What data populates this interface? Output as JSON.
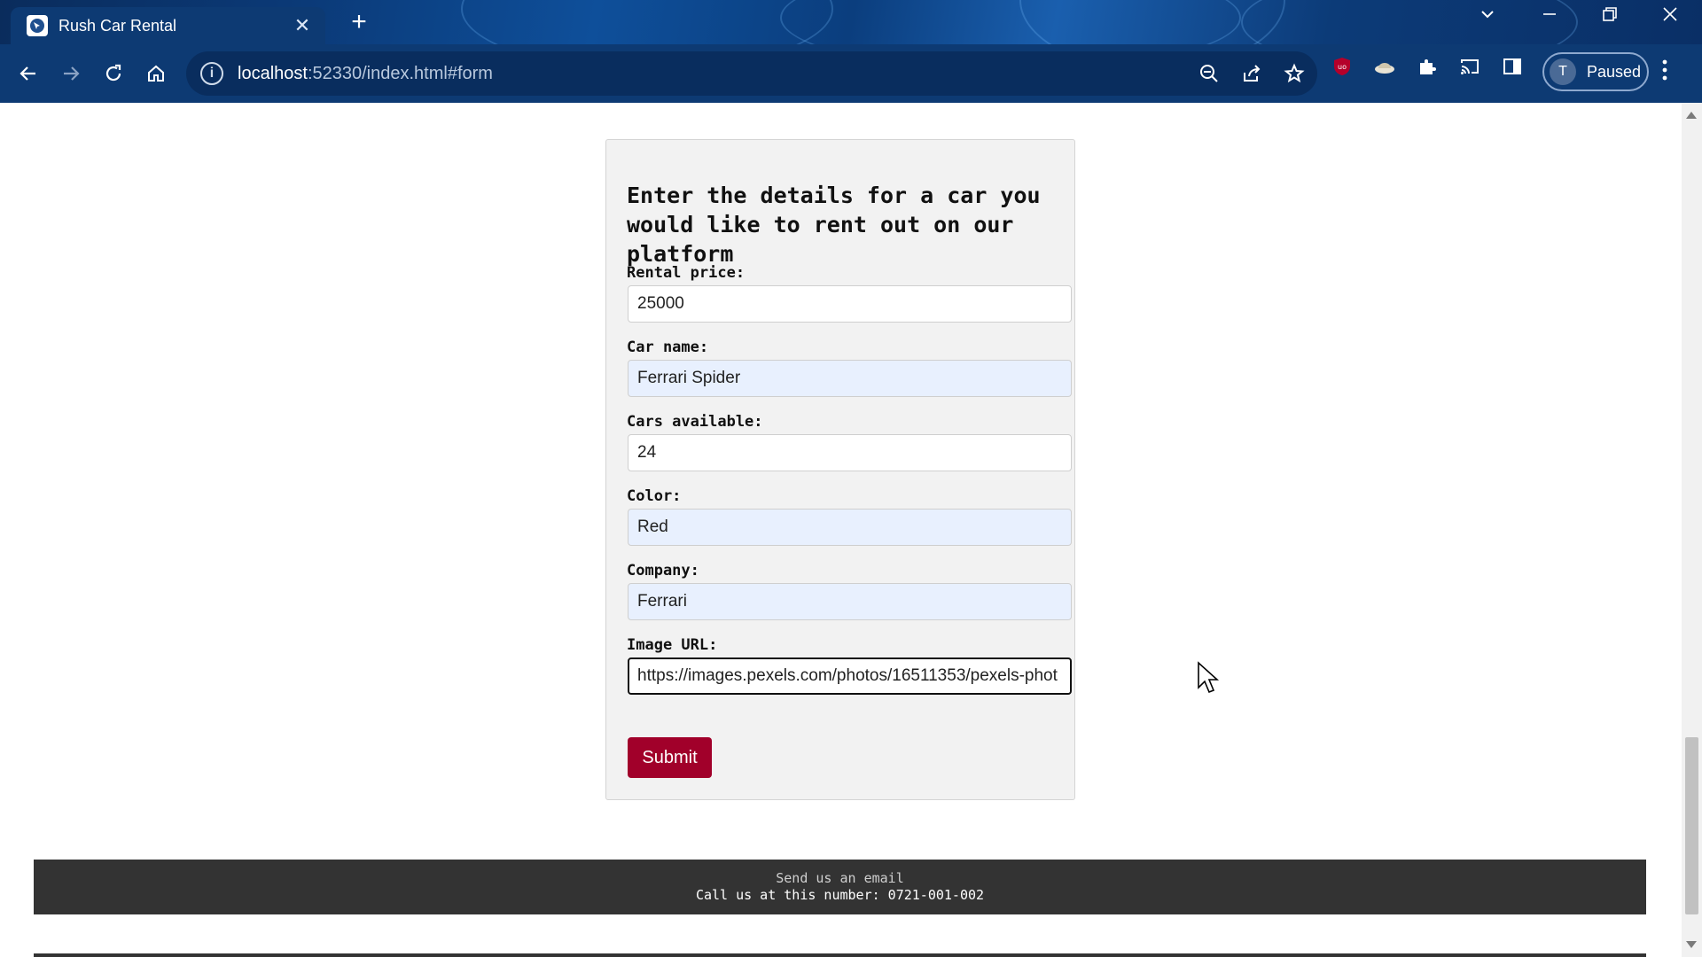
{
  "browser": {
    "tab_title": "Rush Car Rental",
    "tab_close": "✕",
    "new_tab": "+",
    "url_host": "localhost",
    "url_rest": ":52330/index.html#form",
    "profile_initial": "T",
    "profile_status": "Paused"
  },
  "form": {
    "heading": "Enter the details for a car you would like to rent out on our platform",
    "fields": [
      {
        "label": "Rental price:",
        "value": "25000"
      },
      {
        "label": "Car name:",
        "value": "Ferrari Spider"
      },
      {
        "label": "Cars available:",
        "value": "24"
      },
      {
        "label": "Color:",
        "value": "Red"
      },
      {
        "label": "Company:",
        "value": "Ferrari"
      },
      {
        "label": "Image URL:",
        "value": "https://images.pexels.com/photos/16511353/pexels-phot"
      }
    ],
    "submit_label": "Submit"
  },
  "footer": {
    "email_text": "Send us an email",
    "phone_text": "Call us at this number: 0721-001-002"
  },
  "colors": {
    "submit_bg": "#a1002a",
    "footer_bg": "#333333",
    "autofill_bg": "#e8f0fe"
  }
}
